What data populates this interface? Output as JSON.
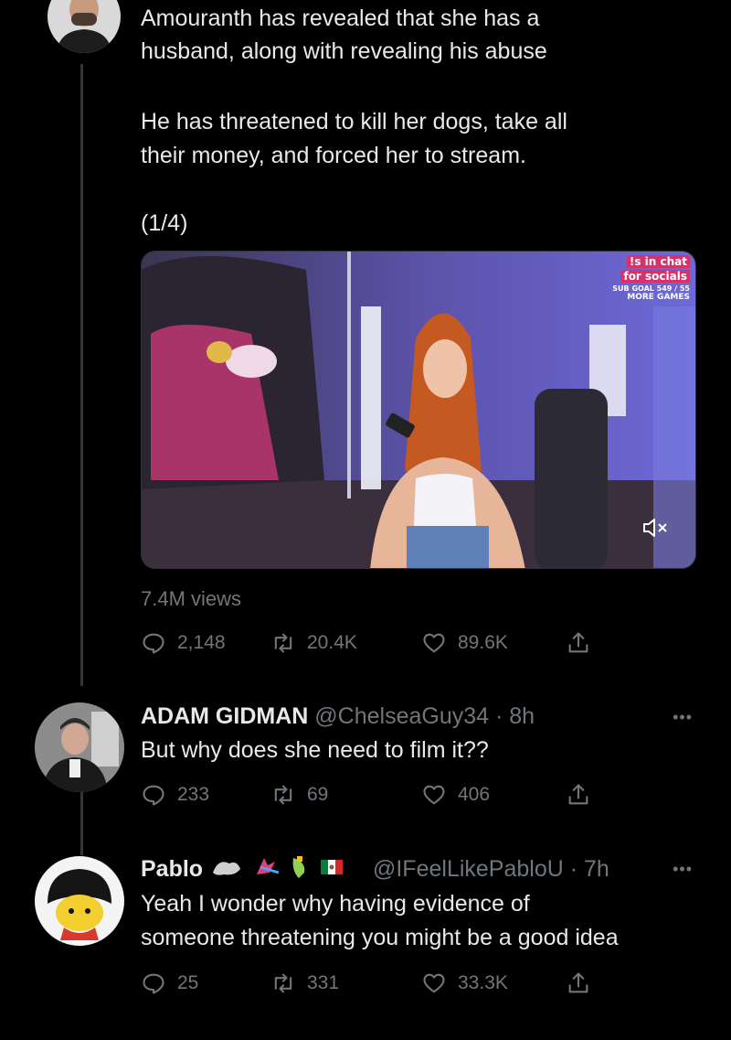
{
  "main_tweet": {
    "text_line1": "Amouranth has revealed that she has a",
    "text_line2": "husband, along with revealing his abuse",
    "text_line3": "He has threatened to kill her dogs, take all",
    "text_line4": "their money, and forced her to stream.",
    "text_line5": "(1/4)",
    "media_overlay": {
      "chat": "!s in chat",
      "socials": "for socials",
      "sub": "SUB GOAL 549 / 55",
      "games": "MORE GAMES"
    },
    "views": "7.4M views",
    "replies": "2,148",
    "retweets": "20.4K",
    "likes": "89.6K"
  },
  "reply1": {
    "name": "ADAM GIDMAN",
    "handle": "@ChelseaGuy34 · 8h",
    "text": "But why does she need to film it??",
    "replies": "233",
    "retweets": "69",
    "likes": "406",
    "more": "•••"
  },
  "reply2": {
    "name": "Pablo",
    "handle": "@IFeelLikePabloU · 7h",
    "text_line1": "Yeah I wonder why having evidence of",
    "text_line2": "someone threatening you might be a good idea",
    "replies": "25",
    "retweets": "331",
    "likes": "33.3K",
    "more": "•••"
  },
  "icons": [
    "reply-icon",
    "retweet-icon",
    "like-icon",
    "share-icon",
    "mute-icon",
    "more-icon"
  ],
  "colors": {
    "background": "#000000",
    "text": "#e7e9ea",
    "muted": "#71767b",
    "thread": "#333639"
  }
}
